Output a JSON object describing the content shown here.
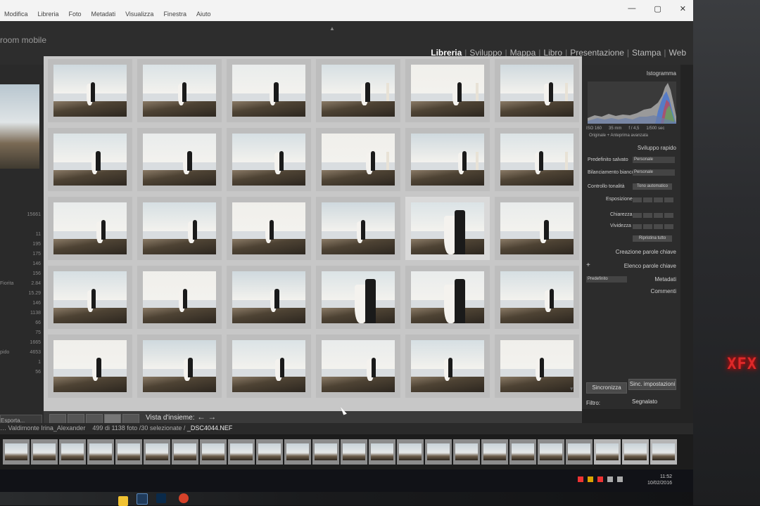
{
  "window": {
    "menu": [
      "Modifica",
      "Libreria",
      "Foto",
      "Metadati",
      "Visualizza",
      "Finestra",
      "Aiuto"
    ],
    "controls": [
      "—",
      "▢",
      "✕"
    ]
  },
  "catalog": {
    "name": "room mobile"
  },
  "modules": [
    "Libreria",
    "Sviluppo",
    "Mappa",
    "Libro",
    "Presentazione",
    "Stampa",
    "Web"
  ],
  "active_module": "Libreria",
  "left_panel": {
    "rows": [
      {
        "label": "",
        "value": "15661"
      },
      {
        "label": "",
        "value": ""
      },
      {
        "label": "",
        "value": "11"
      },
      {
        "label": "",
        "value": "195"
      },
      {
        "label": "",
        "value": "175"
      },
      {
        "label": "",
        "value": "146"
      },
      {
        "label": "",
        "value": "156"
      },
      {
        "label": "Fiorita",
        "value": "2.84"
      },
      {
        "label": "",
        "value": "15.29"
      },
      {
        "label": "",
        "value": "146"
      },
      {
        "label": "",
        "value": "1138"
      },
      {
        "label": "",
        "value": "66"
      },
      {
        "label": "",
        "value": "75"
      },
      {
        "label": "",
        "value": "1665"
      },
      {
        "label": "pido",
        "value": "4653"
      },
      {
        "label": "",
        "value": "1"
      },
      {
        "label": "",
        "value": "56"
      }
    ],
    "export_label": "Esporta..."
  },
  "grid": {
    "rows": 5,
    "cols": 6,
    "scroll_indicator": "▾",
    "top_indicator": "▲"
  },
  "toolbar": {
    "label": "Vista d'insieme:",
    "prev": "←",
    "next": "→"
  },
  "right_panel": {
    "histogram_title": "Istogramma",
    "hist_info": [
      "ISO 160",
      "35 mm",
      "f / 4,5",
      "1/500 sec"
    ],
    "hist_sub": "Originale + Anteprima avanzata",
    "quick_develop_title": "Sviluppo rapido",
    "saved_preset_label": "Predefinito salvato",
    "saved_preset_value": "Personale",
    "wb_label": "Bilanciamento bianco",
    "wb_value": "Personale",
    "tone_label": "Controllo tonalità",
    "tone_value": "Tono automatico",
    "sliders": [
      "Esposizione",
      "Chiarezza",
      "Vividezza"
    ],
    "reset_label": "Ripristina tutto",
    "keywording_title": "Creazione parole chiave",
    "keyword_list_title": "Elenco parole chiave",
    "metadata_preset": "Predefinito",
    "metadata_title": "Metadati",
    "comments_title": "Commenti",
    "sync_label": "Sincronizza",
    "sync_settings_label": "Sinc. impostazioni"
  },
  "filmstrip_bar": {
    "path": "… Valdimonte Irina_Alexander",
    "count": "499 di 1138 foto /30 selezionate /",
    "file": "_DSC4044.NEF",
    "filter_label": "Filtro:",
    "filter_value": "Segnalato"
  },
  "taskbar": {
    "time": "11:52",
    "date": "10/02/2016"
  },
  "room": {
    "clock_text": "XFX"
  }
}
